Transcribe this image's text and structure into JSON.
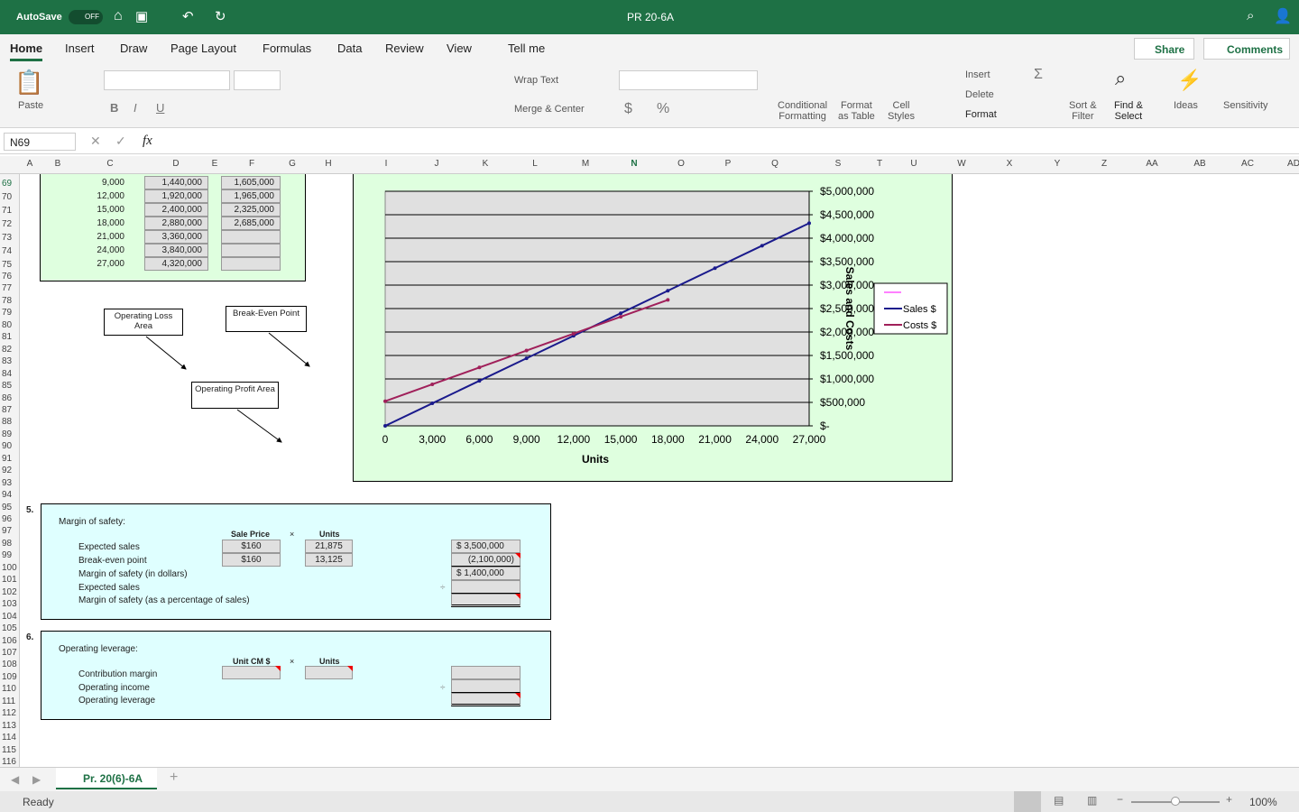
{
  "titlebar": {
    "autosave": "AutoSave",
    "autosave_state": "OFF",
    "doc_title": "PR 20-6A"
  },
  "tabs": [
    "Home",
    "Insert",
    "Draw",
    "Page Layout",
    "Formulas",
    "Data",
    "Review",
    "View",
    "Tell me"
  ],
  "share": "Share",
  "comments": "Comments",
  "ribbon": {
    "paste": "Paste",
    "wrap": "Wrap Text",
    "merge": "Merge & Center",
    "cond": "Conditional",
    "cond2": "Formatting",
    "fmt_table": "Format",
    "fmt_table2": "as Table",
    "cell_styles": "Cell",
    "cell_styles2": "Styles",
    "insert": "Insert",
    "delete": "Delete",
    "format": "Format",
    "sort": "Sort &",
    "sort2": "Filter",
    "find": "Find &",
    "find2": "Select",
    "ideas": "Ideas",
    "sensitivity": "Sensitivity"
  },
  "name_box": "N69",
  "fx": "fx",
  "columns": [
    "A",
    "B",
    "C",
    "D",
    "E",
    "F",
    "G",
    "H",
    "I",
    "J",
    "K",
    "L",
    "M",
    "N",
    "O",
    "P",
    "Q",
    "S",
    "T",
    "U",
    "W",
    "X",
    "Y",
    "Z",
    "AA",
    "AB",
    "AC",
    "AD"
  ],
  "table": {
    "units": [
      "9,000",
      "12,000",
      "15,000",
      "18,000",
      "21,000",
      "24,000",
      "27,000"
    ],
    "sales": [
      "1,440,000",
      "1,920,000",
      "2,400,000",
      "2,880,000",
      "3,360,000",
      "3,840,000",
      "4,320,000"
    ],
    "costs": [
      "1,605,000",
      "1,965,000",
      "2,325,000",
      "2,685,000",
      "",
      "",
      ""
    ]
  },
  "callouts": {
    "loss": "Operating Loss Area",
    "breakeven": "Break-Even Point",
    "profit": "Operating Profit Area"
  },
  "chart_data": {
    "type": "line",
    "xlabel": "Units",
    "ylabel": "Sales and Costs",
    "x": [
      0,
      3000,
      6000,
      9000,
      12000,
      15000,
      18000,
      21000,
      24000,
      27000
    ],
    "xlim": [
      0,
      27000
    ],
    "ylim": [
      0,
      5000000
    ],
    "yticks": [
      "$-",
      "$500,000",
      "$1,000,000",
      "$1,500,000",
      "$2,000,000",
      "$2,500,000",
      "$3,000,000",
      "$3,500,000",
      "$4,000,000",
      "$4,500,000",
      "$5,000,000"
    ],
    "xticks": [
      "0",
      "3,000",
      "6,000",
      "9,000",
      "12,000",
      "15,000",
      "18,000",
      "21,000",
      "24,000",
      "27,000"
    ],
    "grid": true,
    "legend": "right",
    "series": [
      {
        "name": "Sales $",
        "color": "#1a1a8c",
        "values": [
          0,
          480000,
          960000,
          1440000,
          1920000,
          2400000,
          2880000,
          3360000,
          3840000,
          4320000
        ]
      },
      {
        "name": "Costs $",
        "color": "#a0205a",
        "values": [
          525000,
          885000,
          1245000,
          1605000,
          1965000,
          2325000,
          2685000,
          null,
          null,
          null
        ]
      }
    ]
  },
  "mos": {
    "num": "5.",
    "title": "Margin of safety:",
    "h_price": "Sale Price",
    "x": "×",
    "h_units": "Units",
    "rows": [
      "Expected sales",
      "Break-even point",
      "Margin of safety (in dollars)",
      "Expected sales",
      "Margin of safety (as a percentage of sales)"
    ],
    "prices": [
      "$160",
      "$160"
    ],
    "units": [
      "21,875",
      "13,125"
    ],
    "results": [
      "$   3,500,000",
      "(2,100,000)",
      "$   1,400,000",
      "",
      ""
    ],
    "div": "÷"
  },
  "ol": {
    "num": "6.",
    "title": "Operating leverage:",
    "h_cm": "Unit CM $",
    "x": "×",
    "h_units": "Units",
    "rows": [
      "Contribution margin",
      "Operating income",
      "Operating leverage"
    ],
    "div": "÷"
  },
  "sheet_tab": "Pr. 20(6)-6A",
  "status": "Ready",
  "zoom": "100%"
}
